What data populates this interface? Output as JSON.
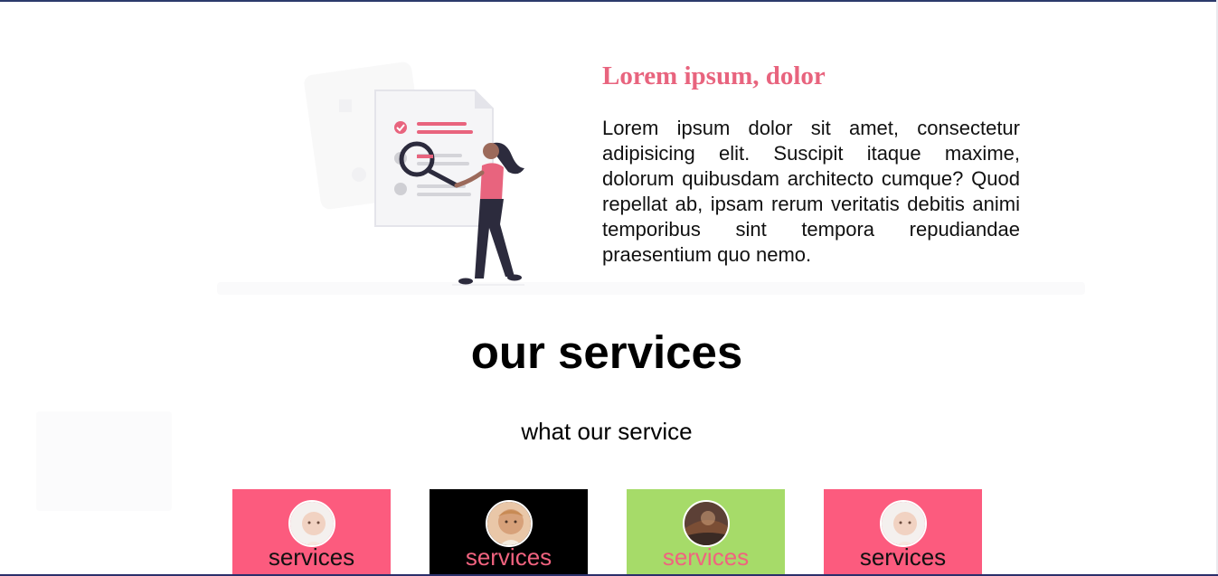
{
  "about": {
    "title": "Lorem ipsum, dolor",
    "text": "Lorem ipsum dolor sit amet, consectetur adipisicing elit. Suscipit itaque maxime, dolorum quibusdam architecto cumque? Quod repellat ab, ipsam rerum veritatis debitis animi temporibus sint tempora repudiandae praesentium quo nemo."
  },
  "services": {
    "title": "our services",
    "subtitle": "what our service",
    "cards": [
      {
        "label": "services",
        "bg": "#fc5b7e",
        "label_color": "#111111",
        "avatar": "baby-photo"
      },
      {
        "label": "services",
        "bg": "#000000",
        "label_color": "#f0637f",
        "avatar": "toddler-photo"
      },
      {
        "label": "services",
        "bg": "#a6db69",
        "label_color": "#f0637f",
        "avatar": "landscape-photo"
      },
      {
        "label": "services",
        "bg": "#fc5b7e",
        "label_color": "#111111",
        "avatar": "baby-photo"
      }
    ]
  },
  "colors": {
    "accent": "#e8647e",
    "pink": "#fc5b7e",
    "green": "#a6db69"
  }
}
